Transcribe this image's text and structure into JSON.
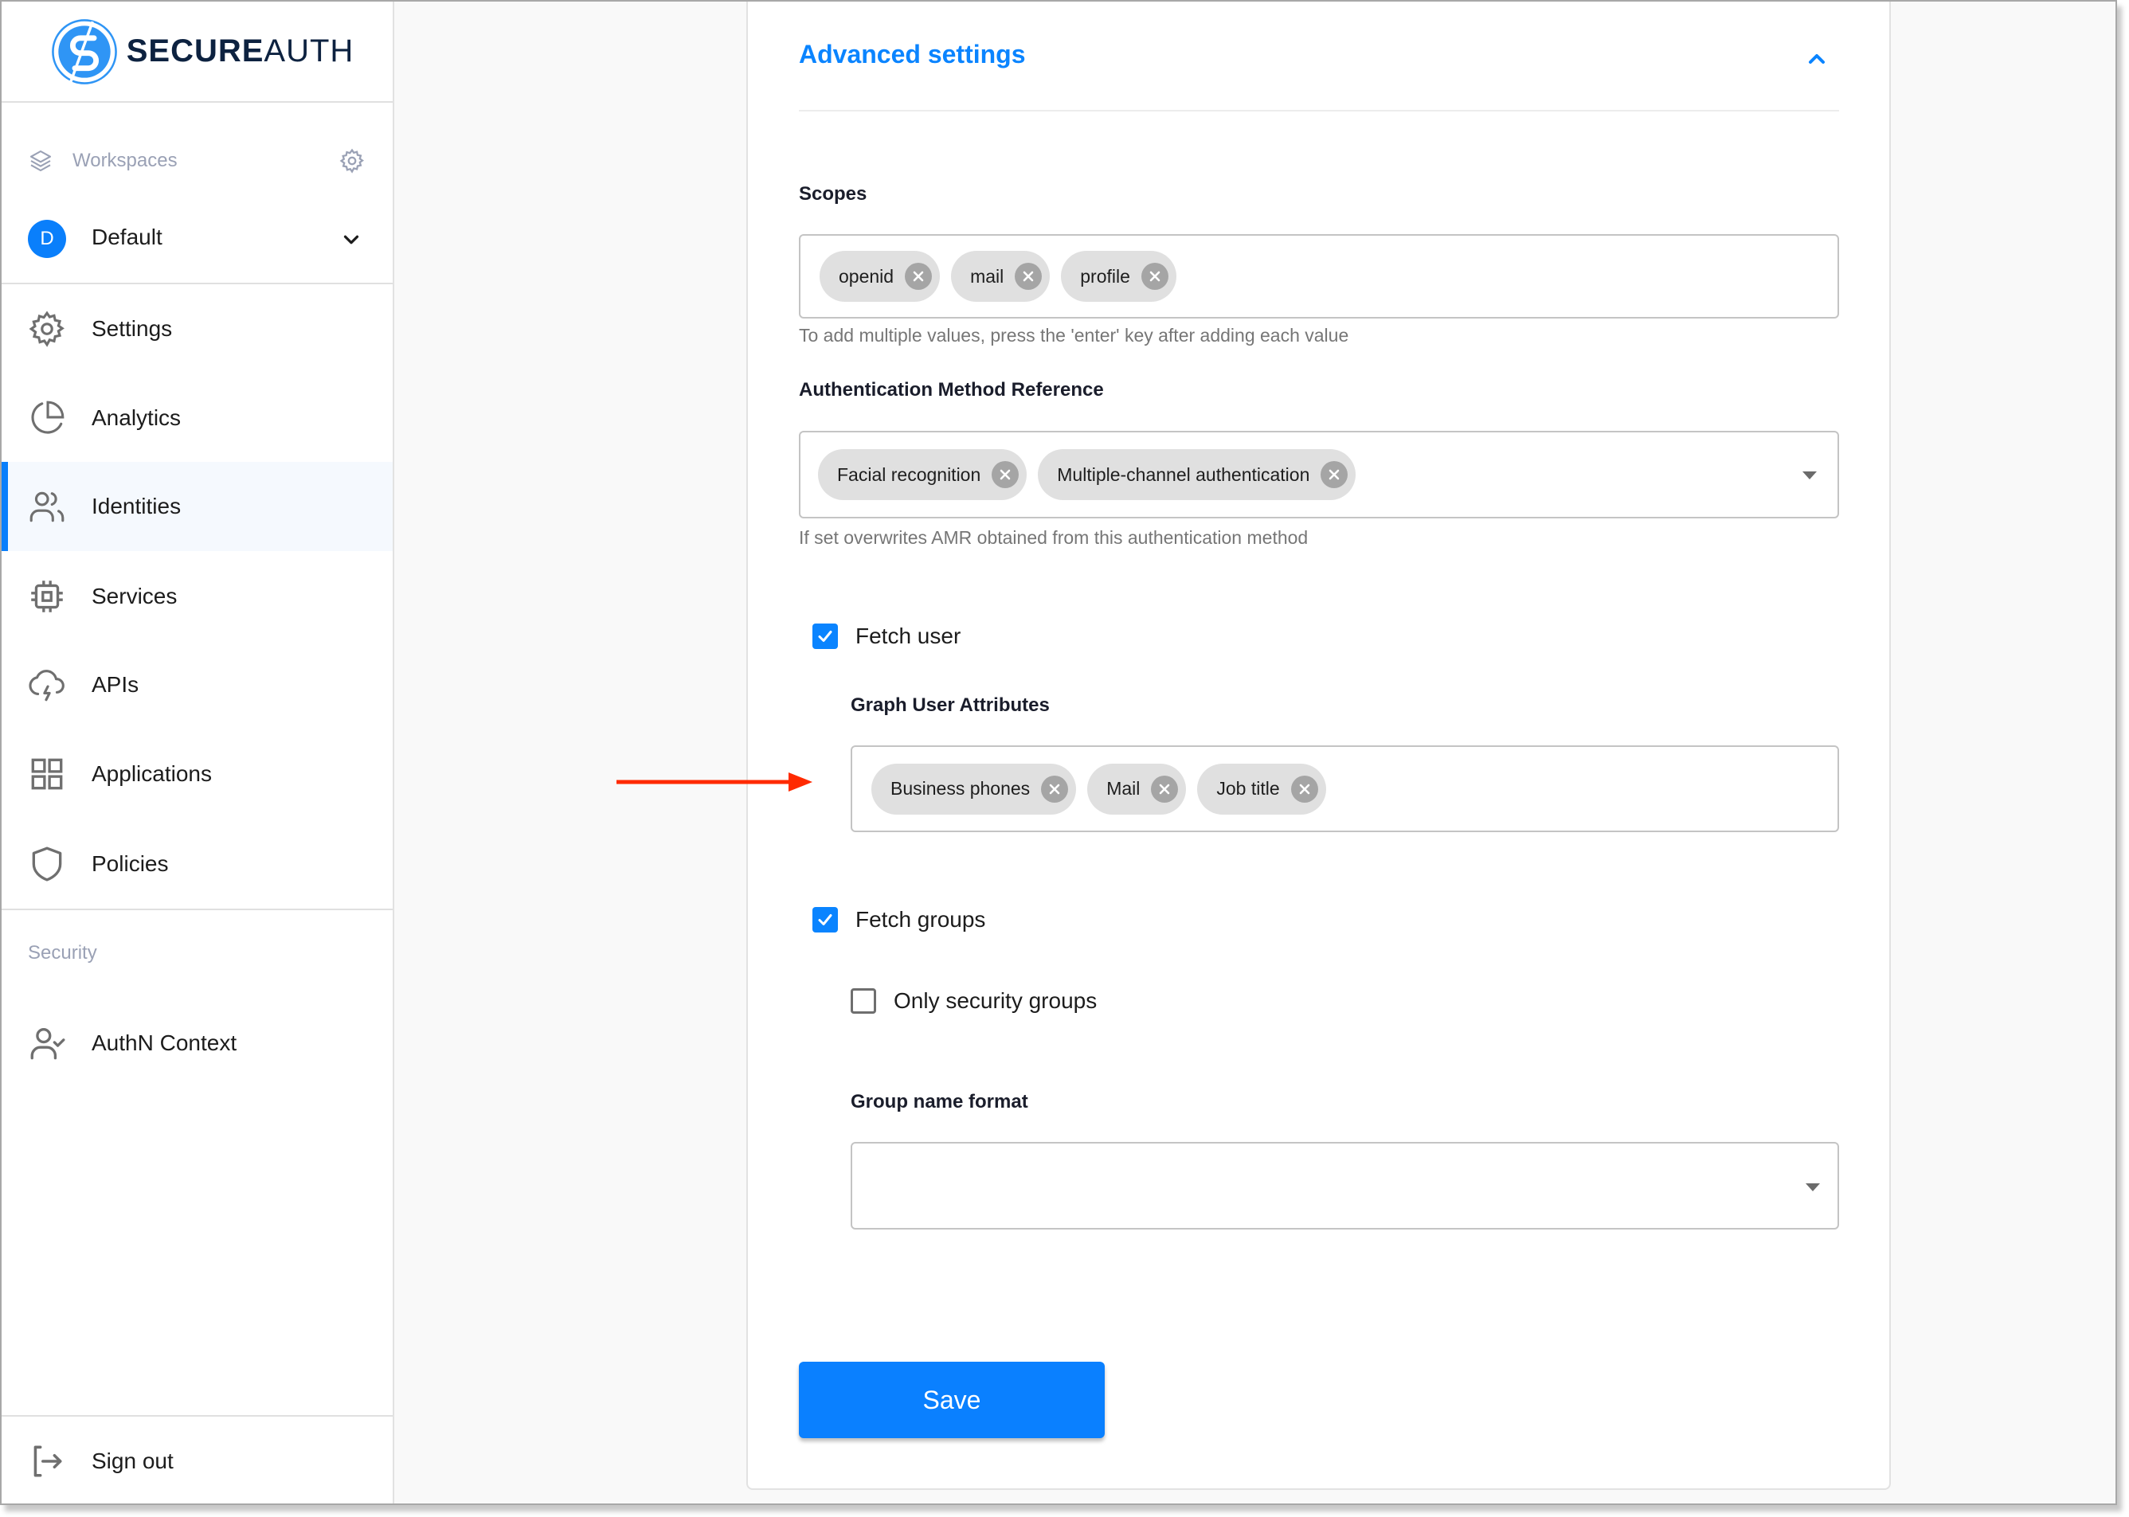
{
  "brand": {
    "name_bold": "SECURE",
    "name_light": "AUTH",
    "logo_icon": "secureauth-logo-icon",
    "colors": {
      "primary": "#0a84ff",
      "logo_blue": "#2f95f5",
      "logo_text": "#0d2240"
    }
  },
  "sidebar": {
    "workspaces_label": "Workspaces",
    "workspace": {
      "avatar_letter": "D",
      "name": "Default"
    },
    "items": [
      {
        "label": "Settings",
        "icon": "gear-icon",
        "active": false
      },
      {
        "label": "Analytics",
        "icon": "pie-chart-icon",
        "active": false
      },
      {
        "label": "Identities",
        "icon": "users-icon",
        "active": true
      },
      {
        "label": "Services",
        "icon": "chip-icon",
        "active": false
      },
      {
        "label": "APIs",
        "icon": "cloud-lightning-icon",
        "active": false
      },
      {
        "label": "Applications",
        "icon": "grid-icon",
        "active": false
      },
      {
        "label": "Policies",
        "icon": "shield-icon",
        "active": false
      }
    ],
    "security_section": {
      "label": "Security",
      "items": [
        {
          "label": "AuthN Context",
          "icon": "user-check-icon"
        }
      ]
    },
    "sign_out_label": "Sign out"
  },
  "main": {
    "section_title": "Advanced settings",
    "section_expanded": true,
    "scopes": {
      "label": "Scopes",
      "values": [
        "openid",
        "mail",
        "profile"
      ],
      "helper": "To add multiple values, press the 'enter' key after adding each value"
    },
    "amr": {
      "label": "Authentication Method Reference",
      "values": [
        "Facial recognition",
        "Multiple-channel authentication"
      ],
      "helper": "If set overwrites AMR obtained from this authentication method"
    },
    "fetch_user": {
      "label": "Fetch user",
      "checked": true
    },
    "graph_user_attributes": {
      "label": "Graph User Attributes",
      "values": [
        "Business phones",
        "Mail",
        "Job title"
      ]
    },
    "fetch_groups": {
      "label": "Fetch groups",
      "checked": true
    },
    "only_security_groups": {
      "label": "Only security groups",
      "checked": false
    },
    "group_name_format": {
      "label": "Group name format",
      "value": ""
    },
    "save_label": "Save",
    "annotation": {
      "type": "arrow",
      "color": "#ff2a00",
      "points_to": "graph-user-attributes-input"
    }
  }
}
